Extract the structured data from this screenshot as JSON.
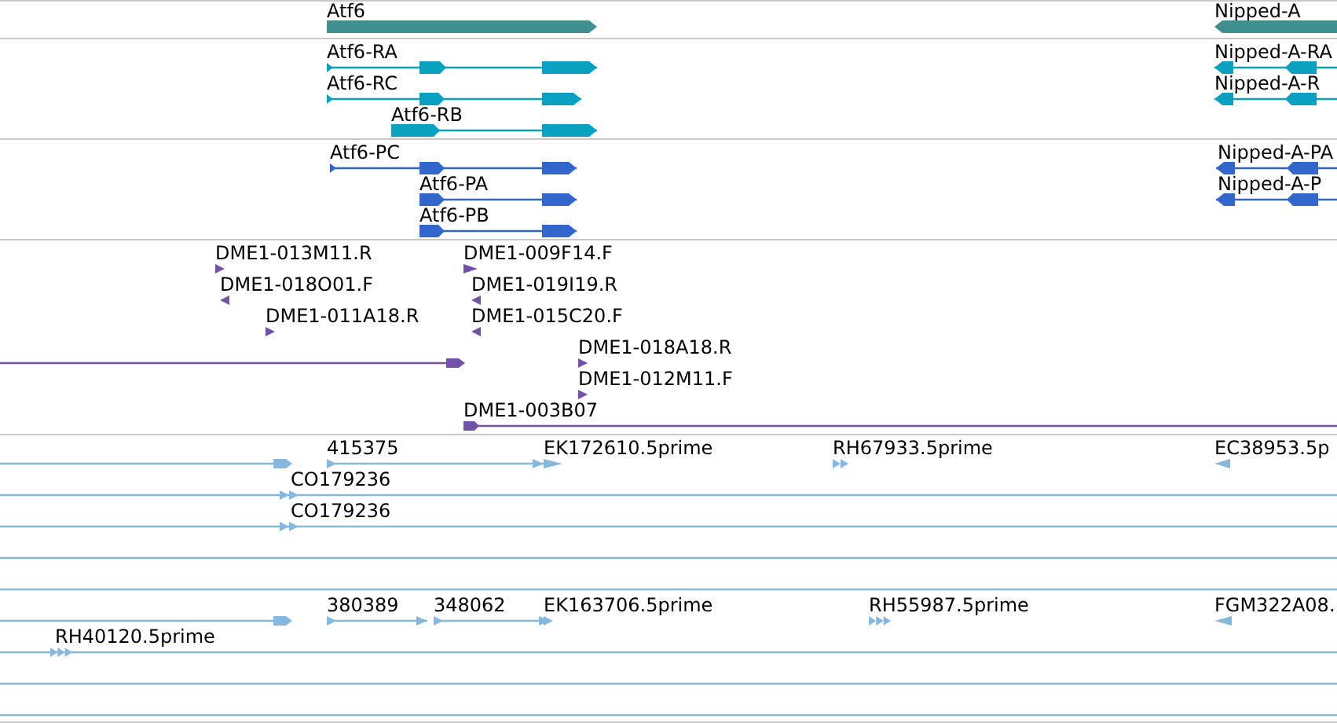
{
  "tracks": [
    {
      "kind": "gene",
      "features": [
        {
          "label": "Atf6",
          "reverse": false
        },
        {
          "label": "Nipped-A",
          "reverse": true
        }
      ]
    },
    {
      "kind": "transcript",
      "features": [
        {
          "label": "Atf6-RA",
          "reverse": false
        },
        {
          "label": "Atf6-RC",
          "reverse": false
        },
        {
          "label": "Atf6-RB",
          "reverse": false
        },
        {
          "label": "Nipped-A-RA",
          "reverse": true
        },
        {
          "label": "Nipped-A-R",
          "reverse": true
        }
      ]
    },
    {
      "kind": "protein",
      "features": [
        {
          "label": "Atf6-PC",
          "reverse": false
        },
        {
          "label": "Atf6-PA",
          "reverse": false
        },
        {
          "label": "Atf6-PB",
          "reverse": false
        },
        {
          "label": "Nipped-A-PA",
          "reverse": true
        },
        {
          "label": "Nipped-A-P",
          "reverse": true
        }
      ]
    },
    {
      "kind": "marker",
      "features": [
        {
          "label": "DME1-013M11.R",
          "reverse": false
        },
        {
          "label": "DME1-018O01.F",
          "reverse": true
        },
        {
          "label": "DME1-011A18.R",
          "reverse": false
        },
        {
          "reverse": false
        },
        {
          "label": "DME1-009F14.F",
          "reverse": false
        },
        {
          "label": "DME1-019I19.R",
          "reverse": true
        },
        {
          "label": "DME1-015C20.F",
          "reverse": true
        },
        {
          "label": "DME1-018A18.R",
          "reverse": false
        },
        {
          "label": "DME1-012M11.F",
          "reverse": false
        },
        {
          "label": "DME1-003B07",
          "reverse": false
        }
      ]
    },
    {
      "kind": "est",
      "features": [
        {
          "reverse": false
        },
        {
          "label": "415375",
          "reverse": false
        },
        {
          "label": "EK172610.5prime",
          "reverse": false
        },
        {
          "label": "RH67933.5prime",
          "reverse": false
        },
        {
          "label": "EC38953.5p",
          "reverse": true
        },
        {
          "label": "CO179236",
          "reverse": false
        },
        {
          "label": "CO179236",
          "reverse": false
        },
        {
          "reverse": false
        },
        {
          "label": "380389",
          "reverse": false
        },
        {
          "label": "348062",
          "reverse": false
        },
        {
          "label": "EK163706.5prime",
          "reverse": false
        },
        {
          "label": "RH55987.5prime",
          "reverse": false
        },
        {
          "label": "FGM322A08.",
          "reverse": true
        },
        {
          "label": "RH40120.5prime",
          "reverse": false
        }
      ]
    }
  ]
}
